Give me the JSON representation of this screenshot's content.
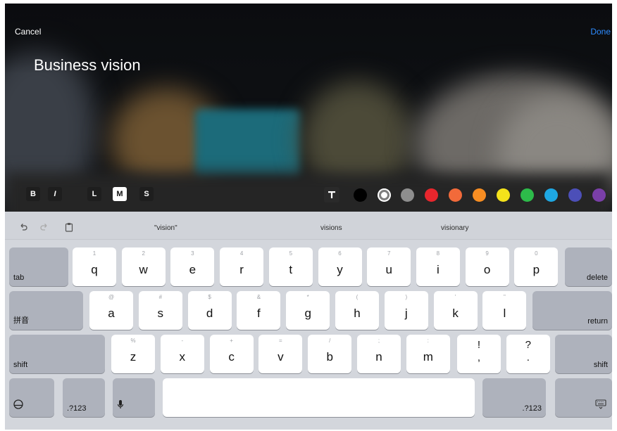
{
  "editor": {
    "cancel_label": "Cancel",
    "done_label": "Done",
    "caption_text": "Business vision",
    "format_buttons": [
      "B",
      "I"
    ],
    "size_buttons": [
      "L",
      "M",
      "S"
    ],
    "selected_size": "M",
    "text_style_icon": "text-style-icon",
    "colors": [
      "#000000",
      "#ffffff",
      "#8e8e8e",
      "#e8262d",
      "#f26a3a",
      "#f78d22",
      "#f4e21b",
      "#2dbb4a",
      "#1ea7e2",
      "#4c4fb8",
      "#7a3fa8"
    ],
    "selected_color": "#ffffff"
  },
  "keyboard": {
    "toolbar_icons": [
      "undo-icon",
      "redo-icon",
      "paste-icon"
    ],
    "suggestions": [
      "\"vision\"",
      "visions",
      "visionary"
    ],
    "row1": {
      "tab": "tab",
      "keys": [
        {
          "main": "q",
          "hint": "1"
        },
        {
          "main": "w",
          "hint": "2"
        },
        {
          "main": "e",
          "hint": "3"
        },
        {
          "main": "r",
          "hint": "4"
        },
        {
          "main": "t",
          "hint": "5"
        },
        {
          "main": "y",
          "hint": "6"
        },
        {
          "main": "u",
          "hint": "7"
        },
        {
          "main": "i",
          "hint": "8"
        },
        {
          "main": "o",
          "hint": "9"
        },
        {
          "main": "p",
          "hint": "0"
        }
      ],
      "delete": "delete"
    },
    "row2": {
      "ime": "拼音",
      "keys": [
        {
          "main": "a",
          "hint": "@"
        },
        {
          "main": "s",
          "hint": "#"
        },
        {
          "main": "d",
          "hint": "$"
        },
        {
          "main": "f",
          "hint": "&"
        },
        {
          "main": "g",
          "hint": "*"
        },
        {
          "main": "h",
          "hint": "("
        },
        {
          "main": "j",
          "hint": ")"
        },
        {
          "main": "k",
          "hint": "'"
        },
        {
          "main": "l",
          "hint": "\""
        }
      ],
      "return": "return"
    },
    "row3": {
      "shift_left": "shift",
      "keys": [
        {
          "main": "z",
          "hint": "%"
        },
        {
          "main": "x",
          "hint": "-"
        },
        {
          "main": "c",
          "hint": "+"
        },
        {
          "main": "v",
          "hint": "="
        },
        {
          "main": "b",
          "hint": "/"
        },
        {
          "main": "n",
          "hint": ";"
        },
        {
          "main": "m",
          "hint": ":"
        }
      ],
      "punct": [
        {
          "top": "!",
          "bottom": ","
        },
        {
          "top": "?",
          "bottom": "."
        }
      ],
      "shift_right": "shift"
    },
    "row4": {
      "globe_icon": "globe-icon",
      "num_left": ".?123",
      "mic_icon": "microphone-icon",
      "space": "",
      "num_right": ".?123",
      "hide_icon": "keyboard-hide-icon"
    }
  }
}
